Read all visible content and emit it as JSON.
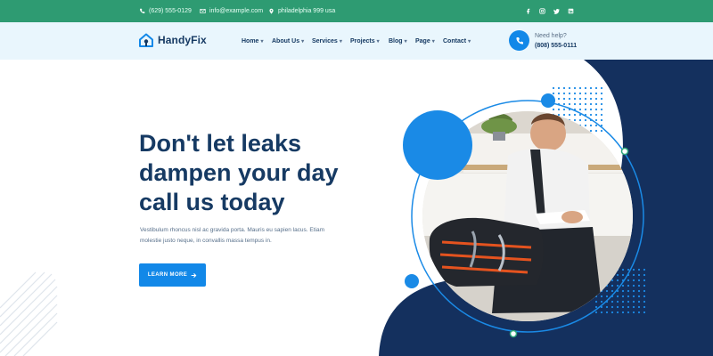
{
  "topbar": {
    "phone": "(629) 555-0129",
    "email": "info@example.com",
    "address": "philadelphia 999 usa",
    "social": [
      "facebook-icon",
      "instagram-icon",
      "twitter-icon",
      "linkedin-icon"
    ]
  },
  "header": {
    "logo_text": "HandyFix",
    "nav": [
      {
        "label": "Home"
      },
      {
        "label": "About Us"
      },
      {
        "label": "Services"
      },
      {
        "label": "Projects"
      },
      {
        "label": "Blog"
      },
      {
        "label": "Page"
      },
      {
        "label": "Contact"
      }
    ],
    "help_label": "Need help?",
    "help_phone": "(808) 555-0111"
  },
  "hero": {
    "title_lines": [
      "Don't let leaks",
      "dampen your day",
      "call us today"
    ],
    "description_lines": [
      "Vestibulum rhoncus nisl ac gravida porta. Mauris eu sapien lacus. Etiam",
      "molestie justo neque, in convallis massa tempus in."
    ],
    "cta_label": "LEARN MORE"
  },
  "colors": {
    "topbar": "#2e9b72",
    "header_bg": "#e9f6fd",
    "navy": "#163a63",
    "accent_blue": "#1288e8",
    "dark_shape": "#14305e"
  }
}
